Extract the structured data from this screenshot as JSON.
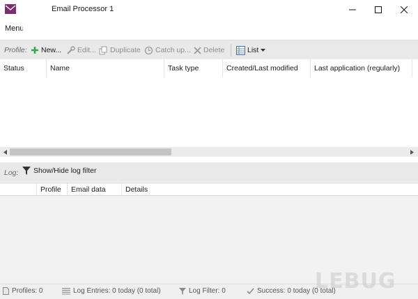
{
  "window": {
    "title": "Email Processor 1"
  },
  "menu": {
    "label": "Menu"
  },
  "toolbar": {
    "label": "Profile:",
    "new_label": "New...",
    "edit_label": "Edit...",
    "duplicate_label": "Duplicate",
    "catch_up_label": "Catch up...",
    "delete_label": "Delete",
    "view_label": "List"
  },
  "profiles_table": {
    "columns": [
      "Status",
      "Name",
      "Task type",
      "Created/Last modified",
      "Last application (regularly)"
    ]
  },
  "log": {
    "label": "Log:",
    "filter_button_label": "Show/Hide log filter",
    "columns": [
      "Profile",
      "Email data",
      "Details"
    ]
  },
  "status_bar": {
    "profiles": "Profiles: 0",
    "log_entries": "Log Entries: 0 today (0 total)",
    "log_filter": "Log Filter: 0",
    "success": "Success: 0 today (0 total)"
  },
  "watermark": "LEBUG",
  "colors": {
    "accent": "#7b2d6e",
    "add_green": "#3aa655",
    "delete_gray": "#9a9a9a"
  }
}
